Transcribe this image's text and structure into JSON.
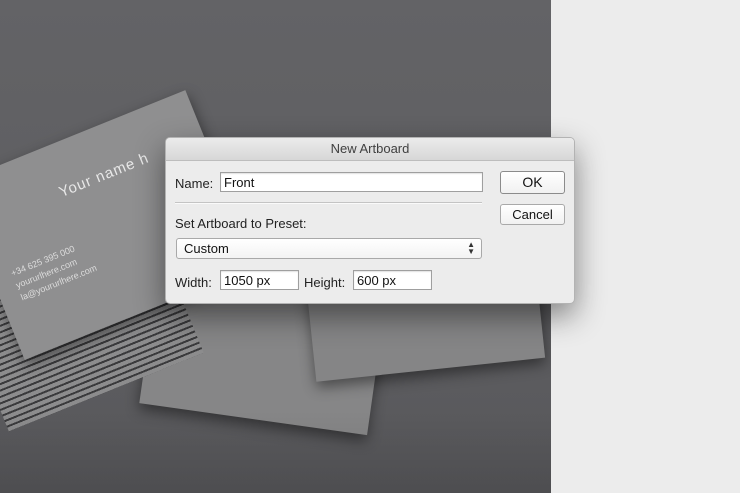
{
  "dialog": {
    "title": "New Artboard",
    "name_label": "Name:",
    "name_value": "Front",
    "preset_label": "Set Artboard to Preset:",
    "preset_value": "Custom",
    "width_label": "Width:",
    "width_value": "1050 px",
    "height_label": "Height:",
    "height_value": "600 px",
    "ok_label": "OK",
    "cancel_label": "Cancel"
  },
  "canvas": {
    "card_name": "Your name h",
    "card_line1": "+34 625 395 000",
    "card_line2": "yoururlhere.com",
    "card_line3": "la@yoururlhere.com"
  },
  "icons": {
    "preset_dropdown": "updown-chevron-icon"
  },
  "colors": {
    "canvas": "#606063",
    "dialog_bg": "#ececec",
    "panel_bg": "#ececec"
  }
}
